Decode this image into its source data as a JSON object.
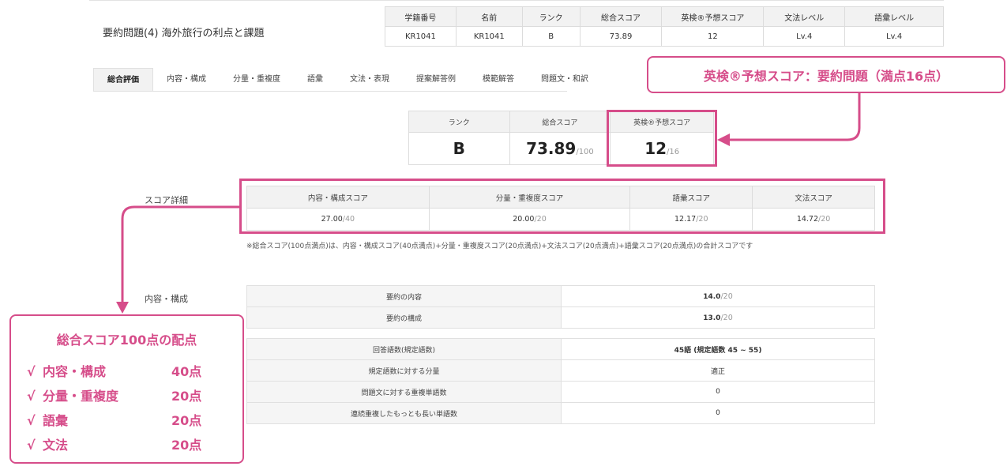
{
  "title": "要約問題(4) 海外旅行の利点と課題",
  "info_table": {
    "headers": [
      "学籍番号",
      "名前",
      "ランク",
      "総合スコア",
      "英検®予想スコア",
      "文法レベル",
      "語彙レベル"
    ],
    "values": [
      "KR1041",
      "KR1041",
      "B",
      "73.89",
      "12",
      "Lv.4",
      "Lv.4"
    ]
  },
  "tabs": [
    "総合評価",
    "内容・構成",
    "分量・重複度",
    "語彙",
    "文法・表現",
    "提案解答例",
    "模範解答",
    "問題文・和訳"
  ],
  "summary": {
    "headers": [
      "ランク",
      "総合スコア",
      "英検®予想スコア"
    ],
    "rank": "B",
    "total": "73.89",
    "total_denom": "/100",
    "eiken": "12",
    "eiken_denom": "/16"
  },
  "score_detail": {
    "label": "スコア詳細",
    "headers": [
      "内容・構成スコア",
      "分量・重複度スコア",
      "語彙スコア",
      "文法スコア"
    ],
    "values": [
      "27.00",
      "20.00",
      "12.17",
      "14.72"
    ],
    "denoms": [
      "/40",
      "/20",
      "/20",
      "/20"
    ],
    "note": "※総合スコア(100点満点)は、内容・構成スコア(40点満点)+分量・重複度スコア(20点満点)+文法スコア(20点満点)+語彙スコア(20点満点)の合計スコアです"
  },
  "content": {
    "label": "内容・構成",
    "rows": [
      {
        "key": "要約の内容",
        "value": "14.0",
        "denom": "/20"
      },
      {
        "key": "要約の構成",
        "value": "13.0",
        "denom": "/20"
      }
    ]
  },
  "volume": {
    "rows": [
      {
        "key": "回答語数(規定語数)",
        "value": "45語 (規定語数 45 ~ 55)"
      },
      {
        "key": "規定語数に対する分量",
        "value": "適正"
      },
      {
        "key": "問題文に対する重複単語数",
        "value": "0"
      },
      {
        "key": "連続重複したもっとも長い単語数",
        "value": "0"
      }
    ]
  },
  "annotations": {
    "callout": "英検®予想スコア：要約問題（満点16点）",
    "legend_title": "総合スコア100点の配点",
    "check": "√",
    "legend_items": [
      {
        "label": "内容・構成",
        "points": "40点"
      },
      {
        "label": "分量・重複度",
        "points": "20点"
      },
      {
        "label": "語彙",
        "points": "20点"
      },
      {
        "label": "文法",
        "points": "20点"
      }
    ],
    "accent_color": "#d64d8a"
  }
}
